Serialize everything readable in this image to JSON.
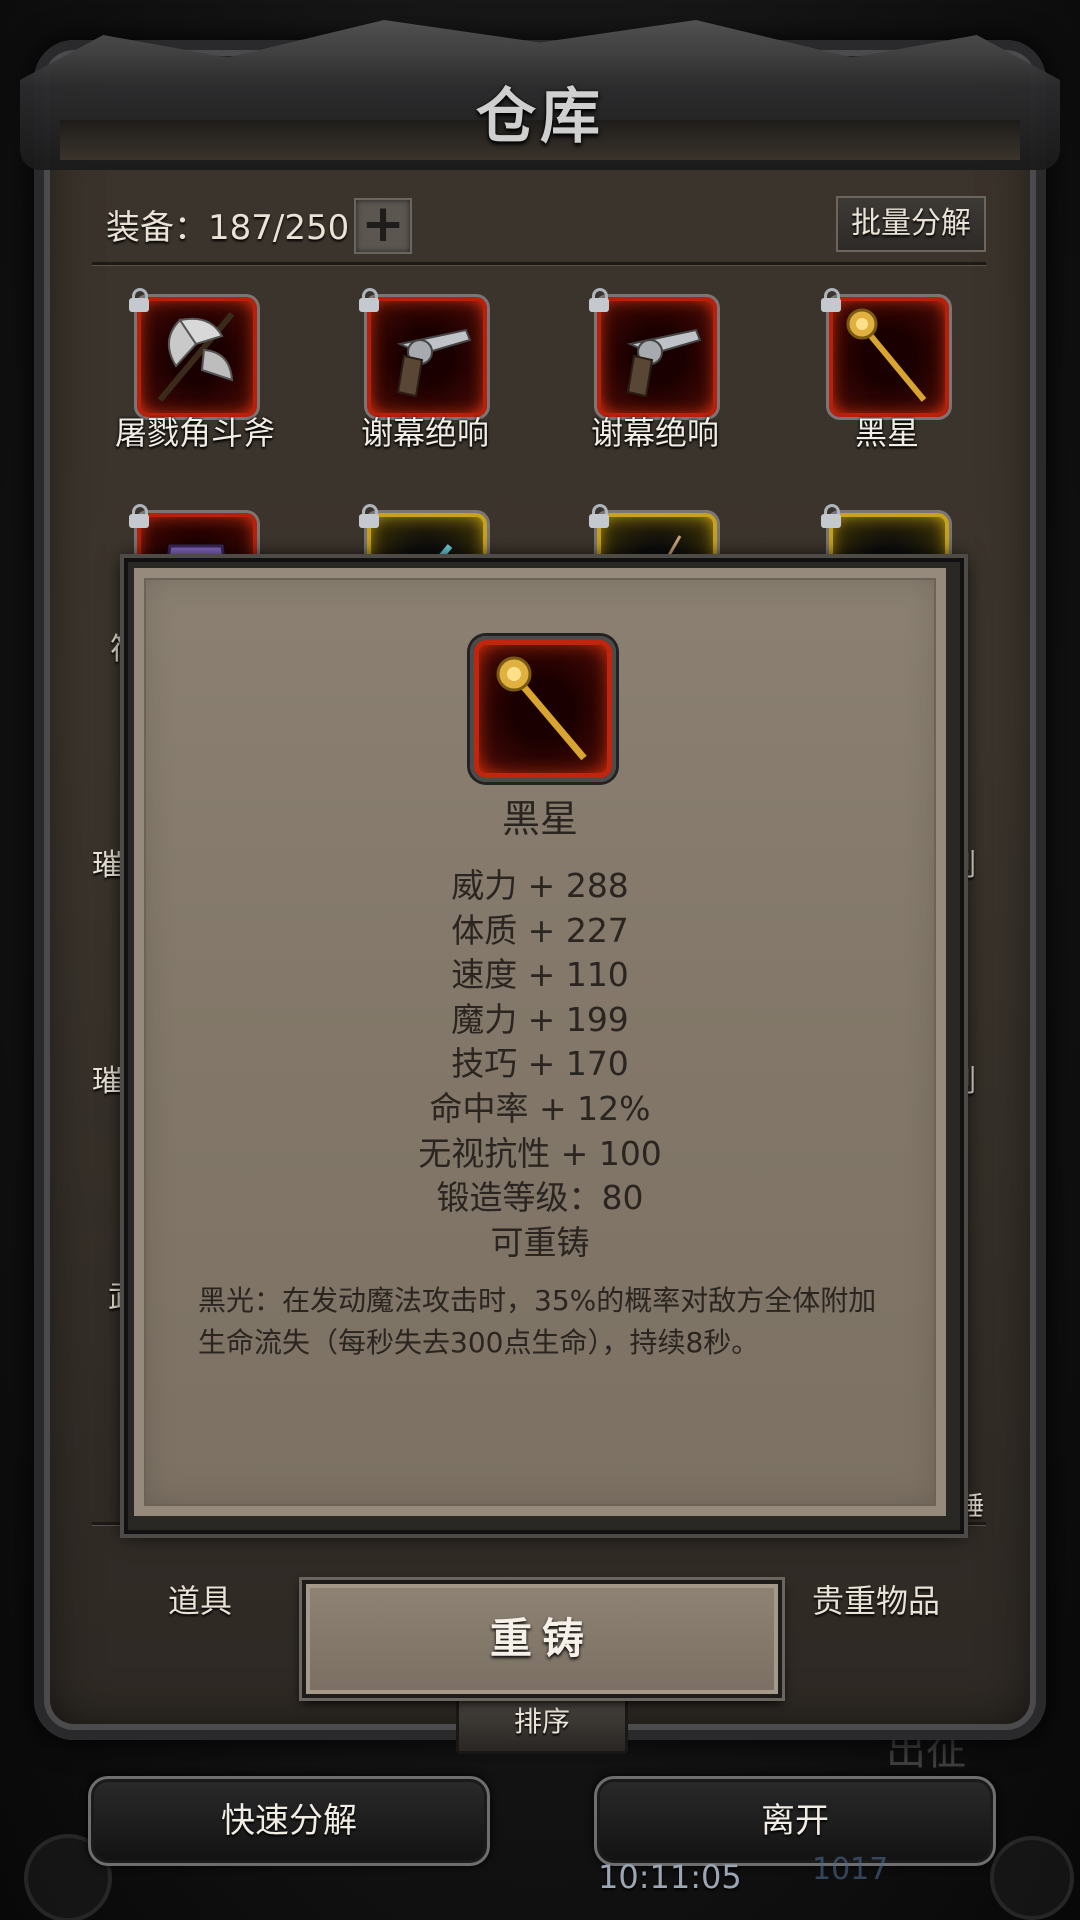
{
  "warehouse": {
    "title": "仓库",
    "equip_count": "装备：187/250",
    "add_symbol": "+",
    "bulk_decompose": "批量分解"
  },
  "items_row1": [
    {
      "name": "屠戮角斗斧",
      "icon": "axe-icon"
    },
    {
      "name": "谢幕绝响",
      "icon": "revolver-icon"
    },
    {
      "name": "谢幕绝响",
      "icon": "revolver-icon"
    },
    {
      "name": "黑星",
      "icon": "golden-staff-icon"
    }
  ],
  "items_row2": [
    {
      "icon": "purple-armor-icon"
    },
    {
      "icon": "blue-sword-icon"
    },
    {
      "icon": "thin-sword-icon"
    },
    {
      "icon": "dark-weapon-icon"
    }
  ],
  "side_labels": {
    "left_1": "符",
    "left_2": "璀",
    "left_3": "璀",
    "left_4": "武",
    "right_1": "剑",
    "right_2": "剑",
    "right_3": "锤"
  },
  "tabs": {
    "items": "道具",
    "valuables": "贵重物品",
    "sort": "排序"
  },
  "tooltip": {
    "name": "黑星",
    "stats": [
      "威力 + 288",
      "体质 + 227",
      "速度 + 110",
      "魔力 + 199",
      "技巧 + 170",
      "命中率 + 12%",
      "无视抗性 + 100",
      "锻造等级：80",
      "可重铸"
    ],
    "description": "黑光：在发动魔法攻击时，35%的概率对敌方全体附加生命流失（每秒失去300点生命），持续8秒。",
    "reforge": "重铸"
  },
  "bottom": {
    "quick_decompose": "快速分解",
    "leave": "离开",
    "time": "10:11:05",
    "bg_number": "1017",
    "bg_word": "出征"
  },
  "colors": {
    "red_frame": "#b8200c",
    "gold_frame": "#c7a21b",
    "panel_bg": "#3c352d",
    "tooltip_bg": "#827768"
  }
}
